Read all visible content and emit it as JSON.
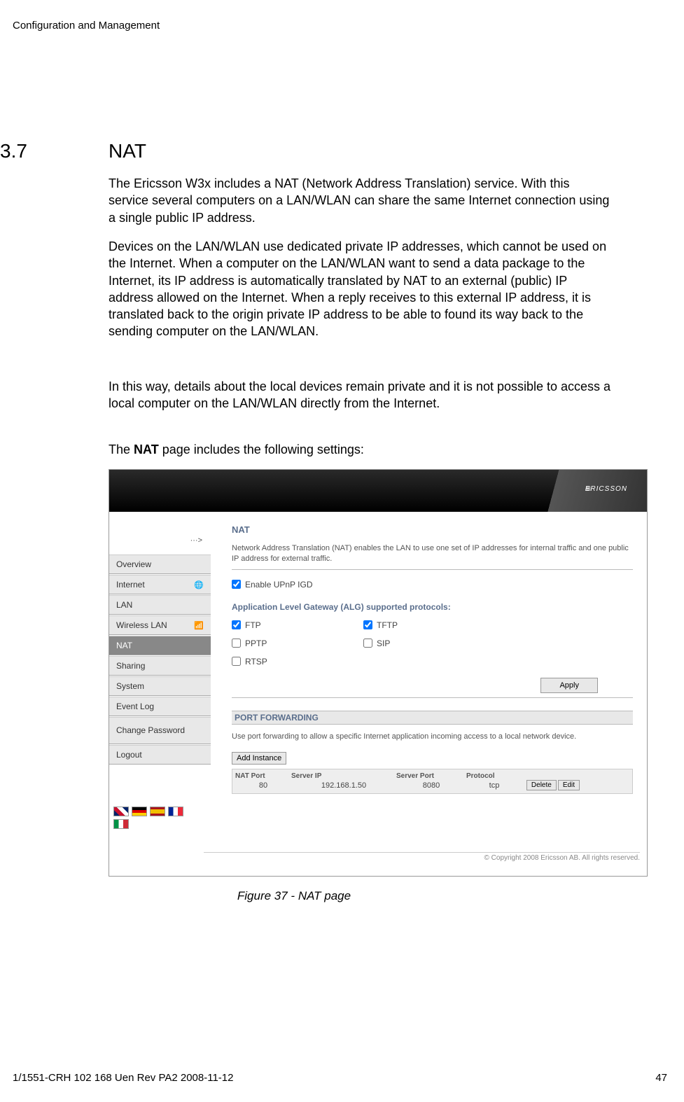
{
  "header": "Configuration and Management",
  "section": {
    "num": "3.7",
    "title": "NAT"
  },
  "para1": "The Ericsson W3x includes a NAT (Network Address Translation) service. With this service several computers on a LAN/WLAN can share the same Internet connection using a single public IP address.",
  "para2": "Devices on the LAN/WLAN use dedicated private IP addresses, which cannot be used on the Internet. When a computer on the LAN/WLAN want to send a data package to the Internet, its IP address is automatically translated by NAT to an external (public) IP address allowed on the Internet. When a reply receives to this external IP address, it is translated back to the origin private IP address to be able to found its way back to the sending computer on the LAN/WLAN.",
  "para3": "In this way, details about the local devices remain private and it is not possible to access a local computer on the LAN/WLAN directly from the Internet.",
  "para4_pre": "The ",
  "para4_bold": "NAT",
  "para4_post": " page includes the following settings:",
  "router": {
    "logo": "ERICSSON",
    "breadcrumb": "···>",
    "nav": {
      "overview": "Overview",
      "internet": "Internet",
      "lan": "LAN",
      "wlan": "Wireless LAN",
      "nat": "NAT",
      "sharing": "Sharing",
      "system": "System",
      "eventlog": "Event Log",
      "changepw": "Change Password",
      "logout": "Logout"
    },
    "panel": {
      "title": "NAT",
      "desc": "Network Address Translation (NAT) enables the LAN to use one set of IP addresses for internal traffic and one public IP address for external traffic.",
      "upnp": "Enable UPnP IGD",
      "alg_title": "Application Level Gateway (ALG) supported protocols:",
      "alg": {
        "ftp": "FTP",
        "tftp": "TFTP",
        "pptp": "PPTP",
        "sip": "SIP",
        "rtsp": "RTSP"
      },
      "apply": "Apply",
      "pf_title": "PORT FORWARDING",
      "pf_desc": "Use port forwarding to allow a specific Internet application incoming access to a local network device.",
      "add_instance": "Add Instance",
      "pf_headers": {
        "natport": "NAT Port",
        "serverip": "Server IP",
        "serverport": "Server Port",
        "protocol": "Protocol"
      },
      "pf_row": {
        "natport": "80",
        "serverip": "192.168.1.50",
        "serverport": "8080",
        "protocol": "tcp"
      },
      "delete": "Delete",
      "edit": "Edit",
      "copyright": "© Copyright 2008 Ericsson AB. All rights reserved."
    }
  },
  "figure_caption": "Figure 37 - NAT page",
  "footer": {
    "left": "1/1551-CRH 102 168 Uen Rev PA2  2008-11-12",
    "right": "47"
  }
}
